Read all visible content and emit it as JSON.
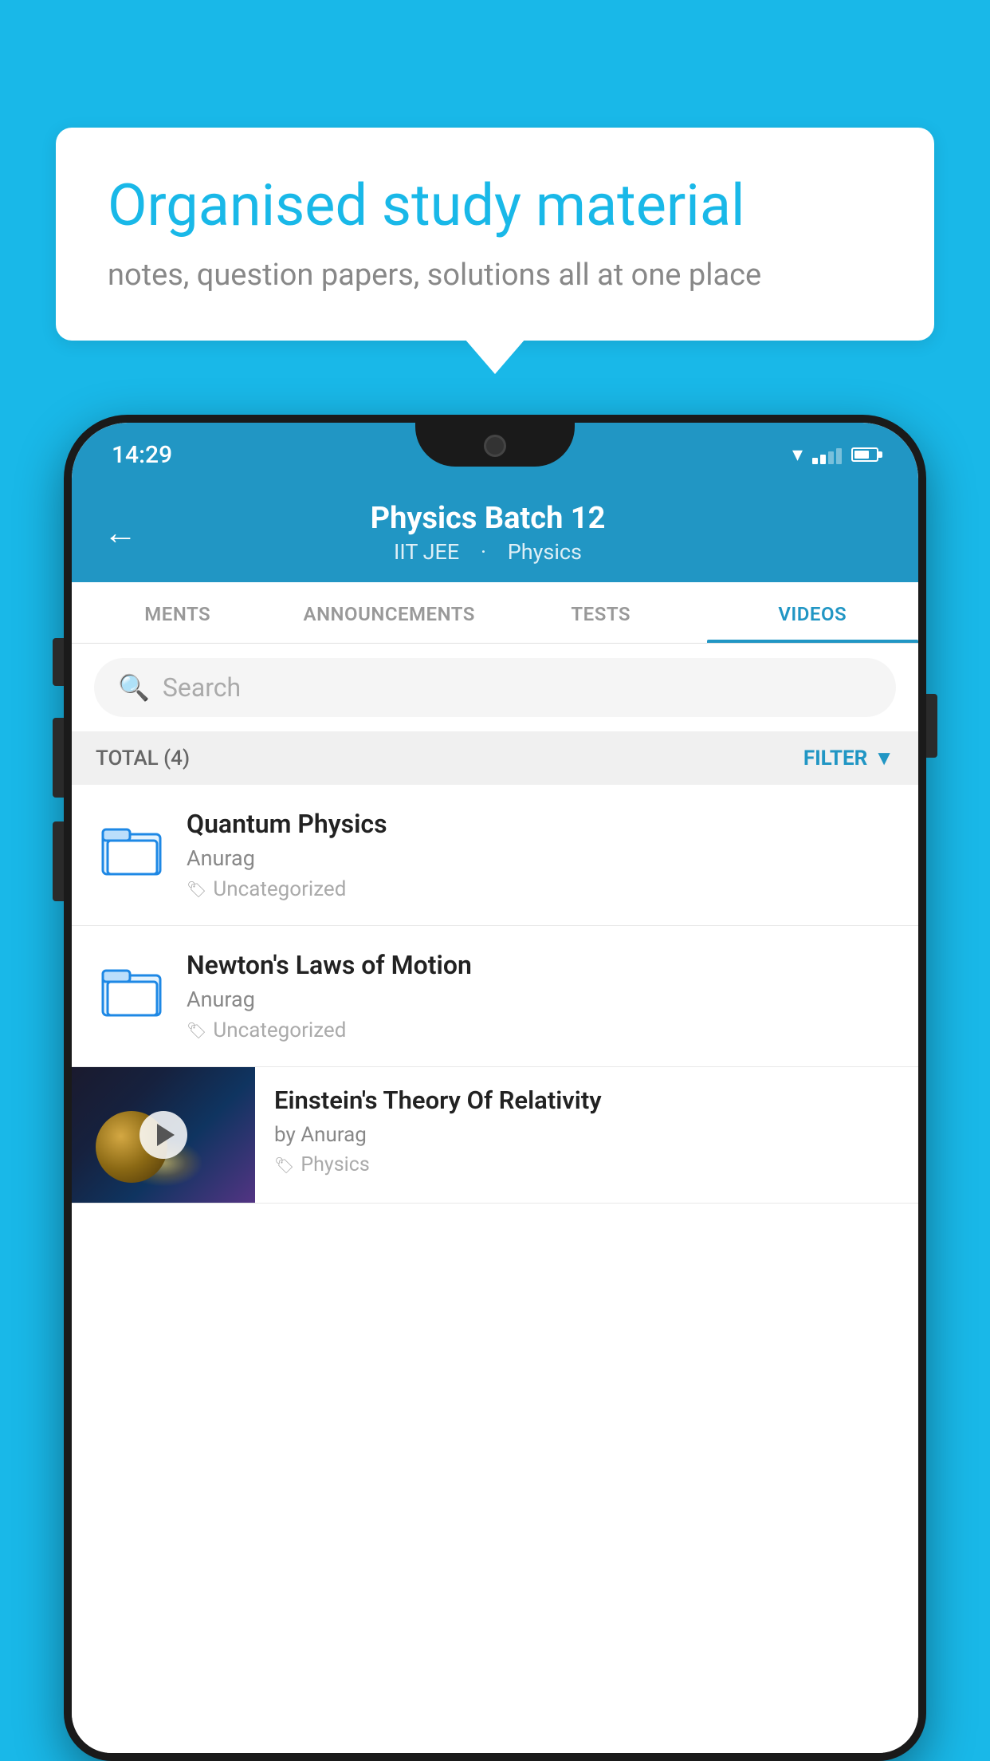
{
  "background": {
    "color": "#19b8e8"
  },
  "speech_bubble": {
    "title": "Organised study material",
    "subtitle": "notes, question papers, solutions all at one place"
  },
  "phone": {
    "status_bar": {
      "time": "14:29"
    },
    "header": {
      "title": "Physics Batch 12",
      "subtitle_part1": "IIT JEE",
      "subtitle_part2": "Physics",
      "back_label": "←"
    },
    "tabs": [
      {
        "label": "MENTS",
        "active": false
      },
      {
        "label": "ANNOUNCEMENTS",
        "active": false
      },
      {
        "label": "TESTS",
        "active": false
      },
      {
        "label": "VIDEOS",
        "active": true
      }
    ],
    "search": {
      "placeholder": "Search"
    },
    "filter_bar": {
      "total": "TOTAL (4)",
      "filter_label": "FILTER"
    },
    "videos": [
      {
        "id": "quantum",
        "title": "Quantum Physics",
        "author": "Anurag",
        "tag": "Uncategorized",
        "has_thumbnail": false
      },
      {
        "id": "newton",
        "title": "Newton's Laws of Motion",
        "author": "Anurag",
        "tag": "Uncategorized",
        "has_thumbnail": false
      },
      {
        "id": "einstein",
        "title": "Einstein's Theory Of Relativity",
        "author": "by Anurag",
        "tag": "Physics",
        "has_thumbnail": true
      }
    ]
  }
}
